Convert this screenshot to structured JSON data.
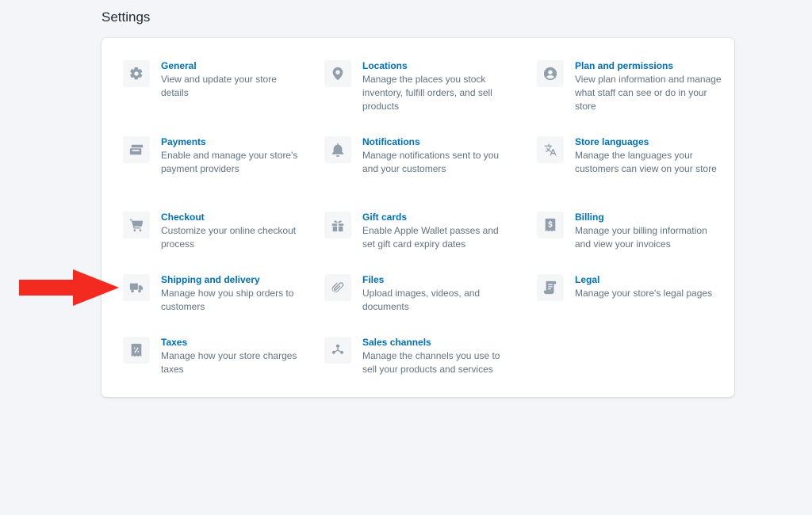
{
  "page": {
    "title": "Settings"
  },
  "accent_color": "#006fbb",
  "annotation_color": "#f22a1f",
  "settings": [
    {
      "icon": "gear-icon",
      "title": "General",
      "description": "View and update your store details"
    },
    {
      "icon": "location-pin-icon",
      "title": "Locations",
      "description": "Manage the places you stock inventory, fulfill orders, and sell products"
    },
    {
      "icon": "user-circle-icon",
      "title": "Plan and permissions",
      "description": "View plan information and manage what staff can see or do in your store"
    },
    {
      "icon": "payment-card-icon",
      "title": "Payments",
      "description": "Enable and manage your store's payment providers"
    },
    {
      "icon": "bell-icon",
      "title": "Notifications",
      "description": "Manage notifications sent to you and your customers"
    },
    {
      "icon": "translate-icon",
      "title": "Store languages",
      "description": "Manage the languages your customers can view on your store"
    },
    {
      "icon": "cart-icon",
      "title": "Checkout",
      "description": "Customize your online checkout process"
    },
    {
      "icon": "gift-icon",
      "title": "Gift cards",
      "description": "Enable Apple Wallet passes and set gift card expiry dates"
    },
    {
      "icon": "billing-receipt-icon",
      "title": "Billing",
      "description": "Manage your billing information and view your invoices"
    },
    {
      "icon": "truck-icon",
      "title": "Shipping and delivery",
      "description": "Manage how you ship orders to customers"
    },
    {
      "icon": "paperclip-icon",
      "title": "Files",
      "description": "Upload images, videos, and documents"
    },
    {
      "icon": "scroll-document-icon",
      "title": "Legal",
      "description": "Manage your store's legal pages"
    },
    {
      "icon": "tax-receipt-icon",
      "title": "Taxes",
      "description": "Manage how your store charges taxes"
    },
    {
      "icon": "sales-channels-icon",
      "title": "Sales channels",
      "description": "Manage the channels you use to sell your products and services"
    }
  ]
}
